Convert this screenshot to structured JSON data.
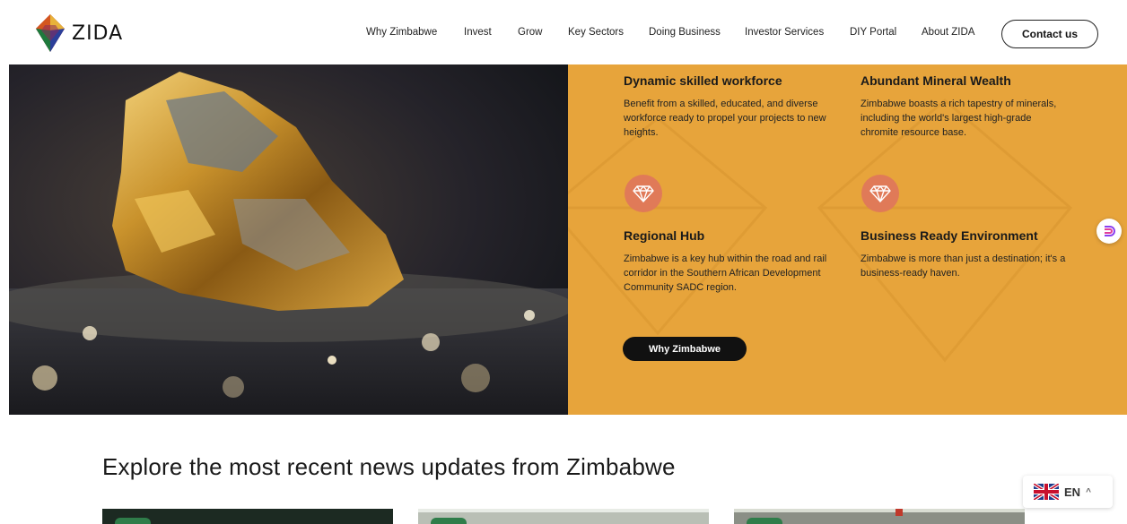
{
  "brand": {
    "name": "ZIDA"
  },
  "nav": {
    "items": [
      "Why Zimbabwe",
      "Invest",
      "Grow",
      "Key Sectors",
      "Doing Business",
      "Investor Services",
      "DIY Portal",
      "About ZIDA"
    ],
    "contact_label": "Contact us"
  },
  "features": [
    {
      "title": "Dynamic skilled workforce",
      "text": "Benefit from a skilled, educated, and diverse workforce ready to propel your projects to new heights."
    },
    {
      "title": "Abundant Mineral Wealth",
      "text": "Zimbabwe boasts a rich tapestry of minerals, including the world's largest high-grade chromite resource base."
    },
    {
      "title": "Regional Hub",
      "text": "Zimbabwe is a key hub within the road and rail corridor in the Southern African Development Community SADC region."
    },
    {
      "title": "Business Ready Environment",
      "text": "Zimbabwe is more than just a destination; it's a business-ready haven."
    }
  ],
  "hero": {
    "cta_label": "Why Zimbabwe",
    "icons": [
      "diamond-icon",
      "diamond-icon"
    ]
  },
  "news": {
    "heading": "Explore the most recent news updates from Zimbabwe"
  },
  "language": {
    "code": "EN",
    "flag": "uk-flag-icon"
  },
  "colors": {
    "panel": "#e7a43b",
    "icon_circle": "#e07a58",
    "button": "#111111"
  }
}
